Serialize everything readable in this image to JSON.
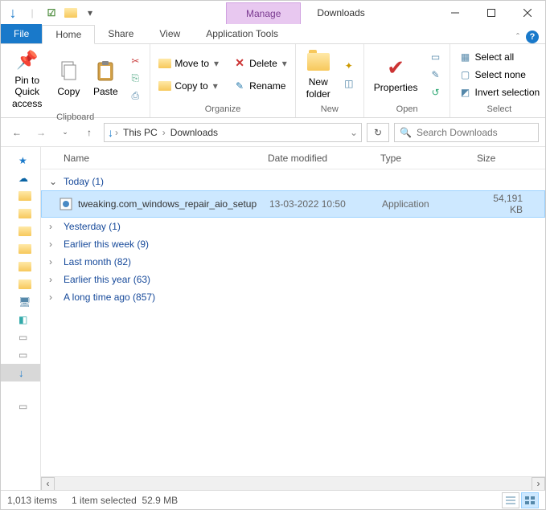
{
  "window": {
    "title": "Downloads",
    "contextTab": "Manage",
    "contextSubTab": "Application Tools"
  },
  "tabs": {
    "file": "File",
    "home": "Home",
    "share": "Share",
    "view": "View"
  },
  "ribbon": {
    "clipboard": {
      "label": "Clipboard",
      "pin": "Pin to Quick access",
      "copy": "Copy",
      "paste": "Paste"
    },
    "organize": {
      "label": "Organize",
      "moveTo": "Move to",
      "copyTo": "Copy to",
      "delete": "Delete",
      "rename": "Rename"
    },
    "new": {
      "label": "New",
      "newFolder": "New folder"
    },
    "open": {
      "label": "Open",
      "properties": "Properties"
    },
    "select": {
      "label": "Select",
      "selectAll": "Select all",
      "selectNone": "Select none",
      "invert": "Invert selection"
    }
  },
  "breadcrumb": {
    "thisPC": "This PC",
    "downloads": "Downloads"
  },
  "search": {
    "placeholder": "Search Downloads"
  },
  "columns": {
    "name": "Name",
    "date": "Date modified",
    "type": "Type",
    "size": "Size"
  },
  "groups": {
    "today": "Today (1)",
    "yesterday": "Yesterday (1)",
    "thisWeek": "Earlier this week (9)",
    "lastMonth": "Last month (82)",
    "thisYear": "Earlier this year (63)",
    "longAgo": "A long time ago (857)"
  },
  "file": {
    "name": "tweaking.com_windows_repair_aio_setup",
    "date": "13-03-2022 10:50",
    "type": "Application",
    "size": "54,191 KB"
  },
  "status": {
    "items": "1,013 items",
    "selected": "1 item selected",
    "selSize": "52.9 MB"
  }
}
